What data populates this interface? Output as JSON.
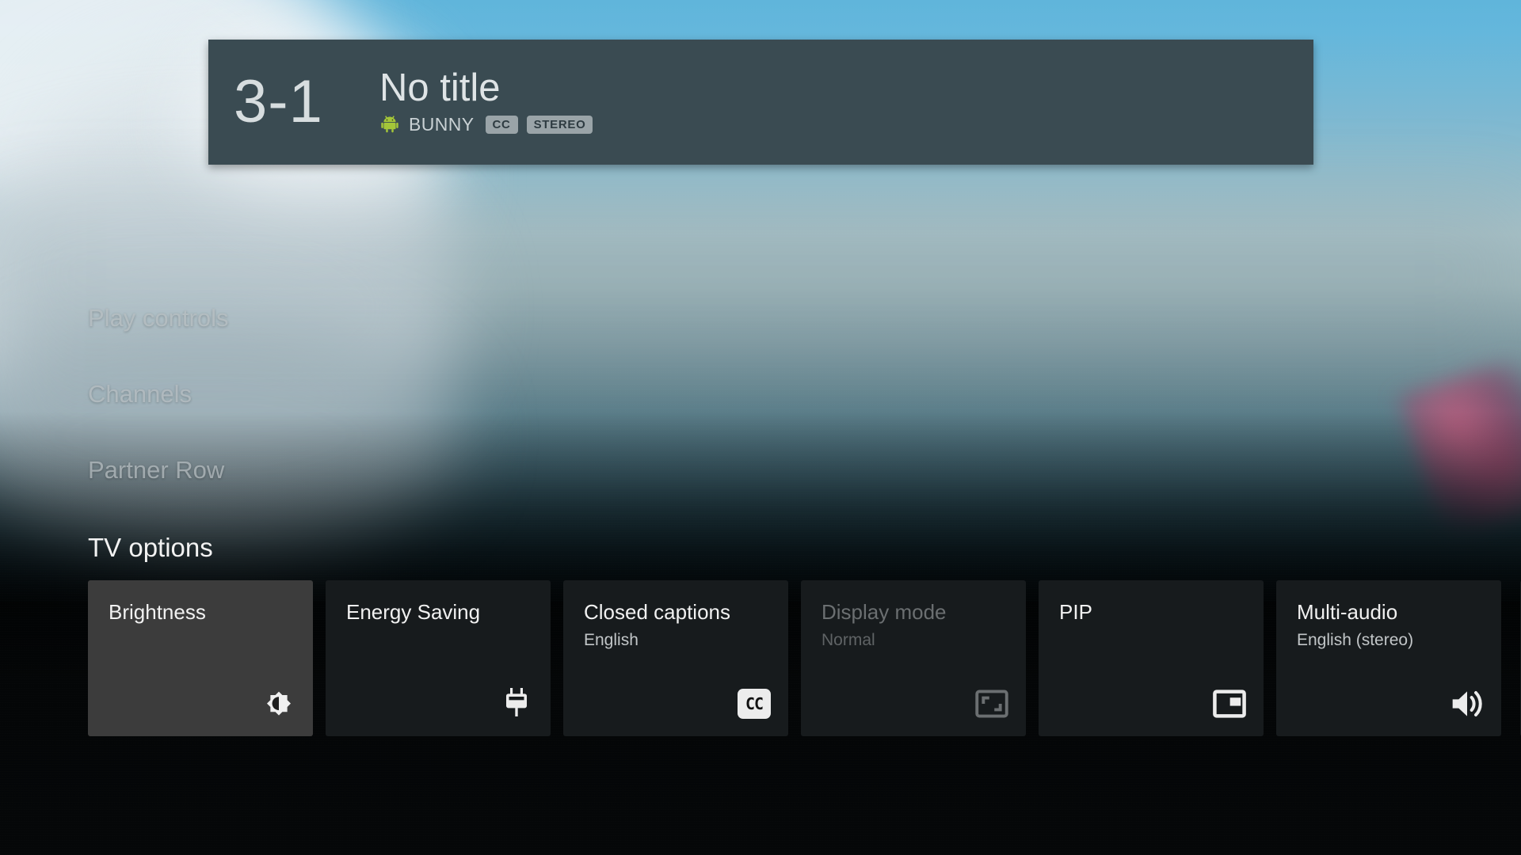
{
  "banner": {
    "channel_number": "3-1",
    "title": "No title",
    "app_icon": "android-robot-icon",
    "app_name": "BUNNY",
    "badges": [
      "CC",
      "STEREO"
    ],
    "background_color": "#3a4b52"
  },
  "menu": {
    "items": [
      {
        "label": "Play controls"
      },
      {
        "label": "Channels"
      },
      {
        "label": "Partner Row"
      }
    ]
  },
  "tv_options": {
    "section_title": "TV options",
    "cards": [
      {
        "title": "Brightness",
        "subtitle": "",
        "icon": "brightness-icon",
        "focused": true,
        "disabled": false
      },
      {
        "title": "Energy Saving",
        "subtitle": "",
        "icon": "power-plug-icon",
        "focused": false,
        "disabled": false
      },
      {
        "title": "Closed captions",
        "subtitle": "English",
        "icon": "closed-caption-icon",
        "focused": false,
        "disabled": false
      },
      {
        "title": "Display mode",
        "subtitle": "Normal",
        "icon": "aspect-ratio-icon",
        "focused": false,
        "disabled": true
      },
      {
        "title": "PIP",
        "subtitle": "",
        "icon": "picture-in-picture-icon",
        "focused": false,
        "disabled": false
      },
      {
        "title": "Multi-audio",
        "subtitle": "English (stereo)",
        "icon": "volume-up-icon",
        "focused": false,
        "disabled": false
      }
    ]
  },
  "colors": {
    "focused_card": "#3c3c3c",
    "card": "#171b1d",
    "banner": "#3a4b52",
    "badge": "#9aa4a8",
    "text_primary": "#f1f1f1",
    "text_secondary": "#c2c6c8",
    "text_disabled": "#6b6f71"
  }
}
